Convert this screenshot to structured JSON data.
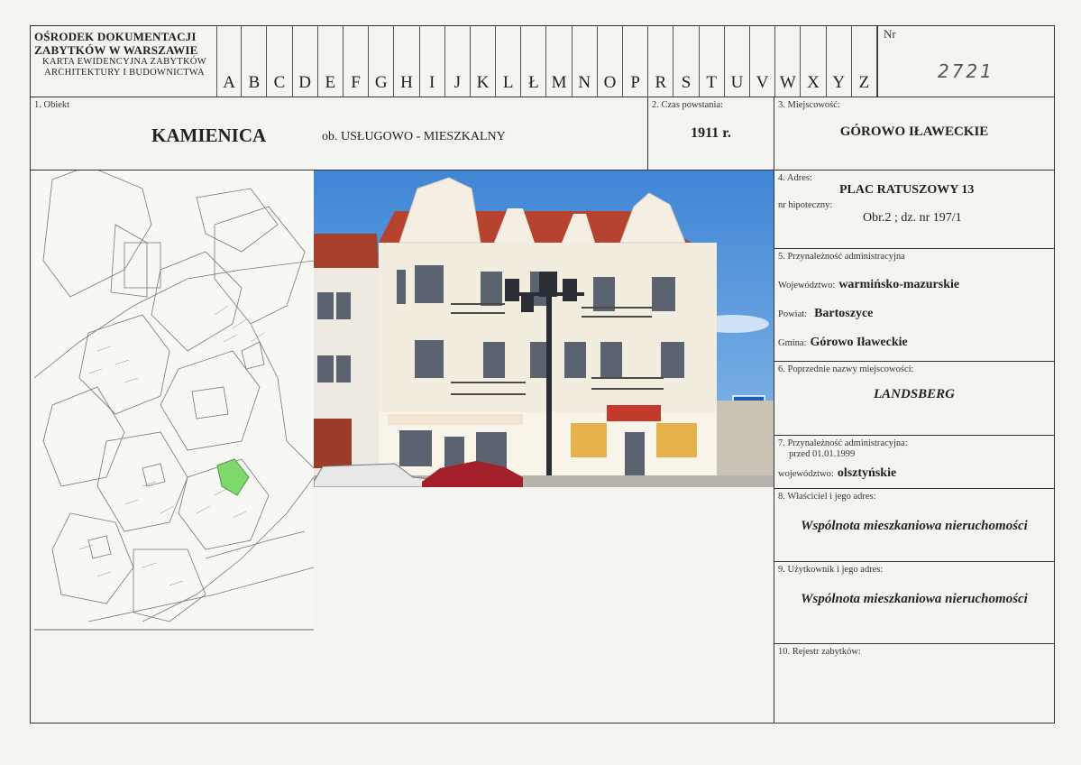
{
  "header": {
    "org_line1": "OŚRODEK DOKUMENTACJI",
    "org_line2": "ZABYTKÓW W WARSZAWIE",
    "card_line1": "KARTA EWIDENCYJNA ZABYTKÓW",
    "card_line2": "ARCHITEKTURY I BUDOWNICTWA",
    "letters": [
      "A",
      "B",
      "C",
      "D",
      "E",
      "F",
      "G",
      "H",
      "I",
      "J",
      "K",
      "L",
      "Ł",
      "M",
      "N",
      "O",
      "P",
      "R",
      "S",
      "T",
      "U",
      "V",
      "W",
      "X",
      "Y",
      "Z"
    ],
    "nr_label": "Nr",
    "nr_value": "2721"
  },
  "object": {
    "label": "1. Obiekt",
    "name": "KAMIENICA",
    "function": "ob. USŁUGOWO - MIESZKALNY"
  },
  "creation": {
    "label": "2. Czas powstania:",
    "value": "1911 r."
  },
  "locality": {
    "label": "3. Miejscowość:",
    "value": "GÓROWO IŁAWECKIE"
  },
  "address": {
    "label": "4. Adres:",
    "value": "PLAC RATUSZOWY 13",
    "mortgage_label": "nr hipoteczny:",
    "mortgage_value": "Obr.2 ; dz. nr 197/1"
  },
  "admin": {
    "label": "5. Przynależność administracyjna",
    "voiv_label": "Województwo:",
    "voiv_value": "warmińsko-mazurskie",
    "county_label": "Powiat:",
    "county_value": "Bartoszyce",
    "commune_label": "Gmina:",
    "commune_value": "Górowo Iławeckie"
  },
  "former_names": {
    "label": "6. Poprzednie nazwy miejscowości:",
    "value": "LANDSBERG"
  },
  "admin_before": {
    "label_line1": "7. Przynależność administracyjna:",
    "label_line2": "przed 01.01.1999",
    "voiv_label": "województwo:",
    "voiv_value": "olsztyńskie"
  },
  "owner": {
    "label": "8. Właściciel i jego adres:",
    "value": "Wspólnota mieszkaniowa nieruchomości"
  },
  "user": {
    "label": "9. Użytkownik i jego adres:",
    "value": "Wspólnota mieszkaniowa nieruchomości"
  },
  "register": {
    "label": "10. Rejestr zabytków:"
  },
  "colors": {
    "ink": "#222222",
    "parcel": "#7fd86a",
    "sky": "#4a90d9",
    "roof": "#b5432f"
  }
}
